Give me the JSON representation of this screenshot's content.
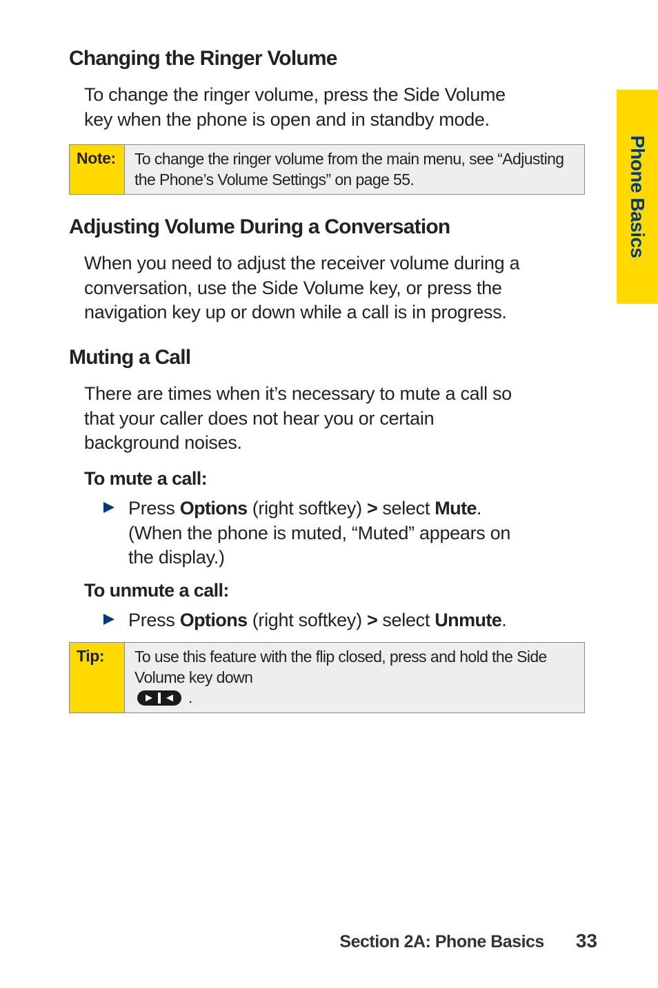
{
  "side_tab": "Phone Basics",
  "sections": {
    "ringer": {
      "heading": "Changing the Ringer Volume",
      "body": "To change the ringer volume, press the Side Volume key when the phone is open and in standby mode."
    },
    "note": {
      "label": "Note:",
      "text": "To change the ringer volume from the main menu, see “Adjusting the Phone’s Volume Settings” on page 55."
    },
    "adjust": {
      "heading": "Adjusting Volume During a Conversation",
      "body": "When you need to adjust the receiver volume during a conversation, use the Side Volume key, or press the navigation key up or down while a call is in progress."
    },
    "muting": {
      "heading": "Muting a Call",
      "body": "There are times when it’s necessary to mute a call so that your caller does not hear you or certain background noises.",
      "to_mute_label": "To mute a call:",
      "mute_step": {
        "press": "Press ",
        "options": "Options",
        "right_softkey": " (right softkey) ",
        "gt": ">",
        "select": " select ",
        "mute": "Mute",
        "rest": ". (When the phone is muted, “Muted” appears on the display.)"
      },
      "to_unmute_label": "To unmute a call:",
      "unmute_step": {
        "press": "Press ",
        "options": "Options",
        "right_softkey": " (right softkey) ",
        "gt": ">",
        "select": " select ",
        "unmute": "Unmute",
        "rest": "."
      }
    },
    "tip": {
      "label": "Tip:",
      "text_before": "To use this feature with the flip closed, press and hold the Side Volume key down",
      "text_after": "."
    }
  },
  "footer": {
    "section": "Section 2A: Phone Basics",
    "page": "33"
  }
}
